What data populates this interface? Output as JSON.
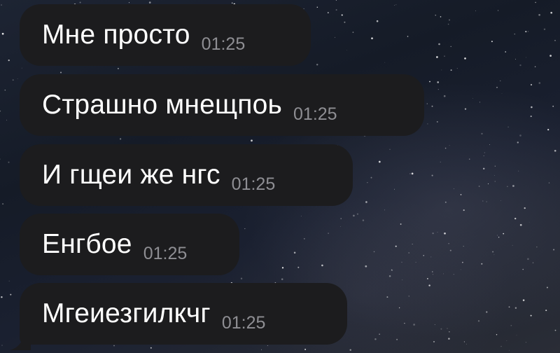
{
  "background": {
    "style": "starry-night-sky",
    "bubble_color": "#1c1c1e",
    "text_color": "#ffffff",
    "time_color": "#8e8e93"
  },
  "messages": [
    {
      "text": "Мне просто",
      "time": "01:25"
    },
    {
      "text": "Страшно мнещпоь",
      "time": "01:25"
    },
    {
      "text": "И гщеи же нгс",
      "time": "01:25"
    },
    {
      "text": "Енгбое",
      "time": "01:25"
    },
    {
      "text": "Мгеиезгилкчг",
      "time": "01:25"
    }
  ]
}
